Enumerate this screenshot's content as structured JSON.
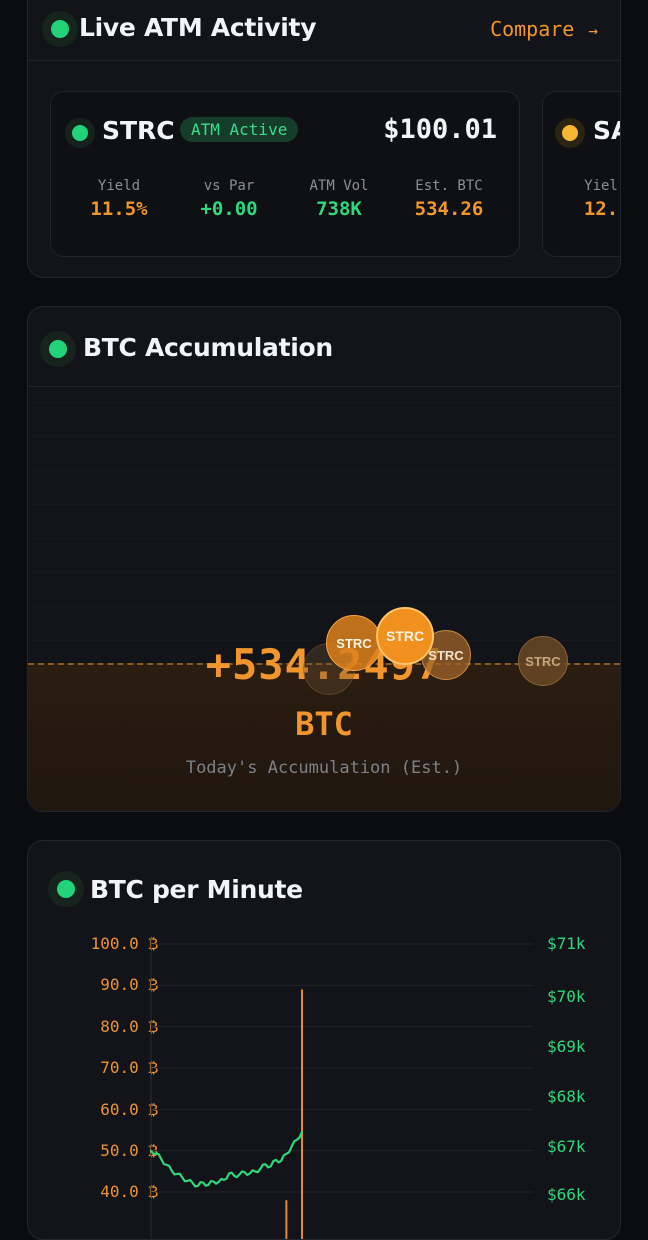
{
  "atm_card": {
    "title": "Live ATM Activity",
    "compare_label": "Compare",
    "compare_arrow": "→",
    "tickers": [
      {
        "name": "STRC",
        "badge": "ATM Active",
        "price": "$100.01",
        "dot_color": "#22d37a",
        "stats": [
          {
            "label": "Yield",
            "value": "11.5%",
            "color": "#f0962c"
          },
          {
            "label": "vs Par",
            "value": "+0.00",
            "color": "#2fd879"
          },
          {
            "label": "ATM Vol",
            "value": "738K",
            "color": "#2fd879"
          },
          {
            "label": "Est. BTC",
            "value": "534.26",
            "color": "#f0962c"
          }
        ]
      },
      {
        "name": "SA",
        "dot_color": "#f5b731",
        "stats": [
          {
            "label": "Yiel",
            "value": "12.",
            "color": "#f0962c"
          }
        ]
      }
    ]
  },
  "accum_card": {
    "title": "BTC Accumulation",
    "value": "+534.2497",
    "unit": "BTC",
    "subtitle": "Today's Accumulation (Est.)",
    "bubbles": [
      "STRC",
      "STRC",
      "STRC",
      "STRC"
    ]
  },
  "permin_card": {
    "title": "BTC per Minute",
    "y_left_ticks": [
      "100.0 ₿",
      "90.0 ₿",
      "80.0 ₿",
      "70.0 ₿",
      "60.0 ₿",
      "50.0 ₿",
      "40.0 ₿"
    ],
    "y_right_ticks": [
      "$71k",
      "$70k",
      "$69k",
      "$68k",
      "$67k",
      "$66k"
    ]
  },
  "chart_data": {
    "type": "line",
    "title": "BTC per Minute",
    "y_left": {
      "unit": "₿",
      "ylim": [
        35,
        100
      ],
      "ticks": [
        100,
        90,
        80,
        70,
        60,
        50,
        40
      ]
    },
    "y_right": {
      "unit": "$k",
      "ylim": [
        65.8,
        71
      ],
      "ticks": [
        71,
        70,
        69,
        68,
        67,
        66
      ]
    },
    "grid": true,
    "series": [
      {
        "axis": "right",
        "color": "#2fd879",
        "values": [
          66.88,
          66.83,
          66.71,
          66.6,
          66.48,
          66.42,
          66.35,
          66.28,
          66.24,
          66.18,
          66.25,
          66.2,
          66.27,
          66.26,
          66.3,
          66.43,
          66.38,
          66.41,
          66.45,
          66.43,
          66.47,
          66.52,
          66.61,
          66.57,
          66.7,
          66.68,
          66.82,
          66.96,
          67.1,
          67.26
        ]
      },
      {
        "axis": "left",
        "color": "#e88a2e",
        "values": [
          0,
          0,
          0,
          0,
          0,
          0,
          0,
          0,
          0,
          0,
          0,
          0,
          0,
          0,
          0,
          0,
          0,
          0,
          0,
          0,
          0,
          0,
          0,
          0,
          0,
          0,
          38.0,
          0,
          0,
          89.0
        ]
      }
    ]
  }
}
